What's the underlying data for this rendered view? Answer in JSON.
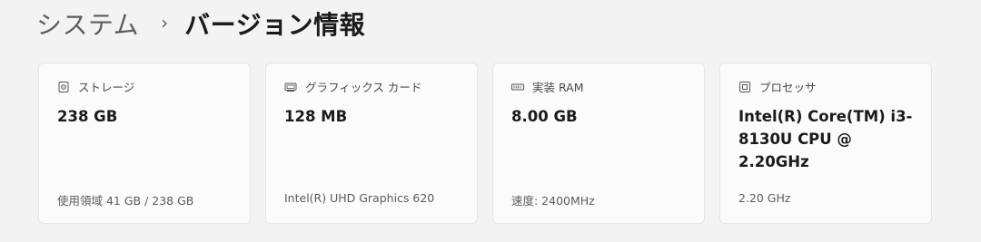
{
  "breadcrumb": {
    "parent": "システム",
    "separator": "›",
    "current": "バージョン情報"
  },
  "cards": [
    {
      "icon": "storage-icon",
      "title": "ストレージ",
      "value": "238 GB",
      "detail": "使用領域 41 GB / 238 GB"
    },
    {
      "icon": "graphics-card-icon",
      "title": "グラフィックス カード",
      "value": "128 MB",
      "detail": "Intel(R) UHD Graphics 620"
    },
    {
      "icon": "memory-icon",
      "title": "実装 RAM",
      "value": "8.00 GB",
      "detail": "速度: 2400MHz"
    },
    {
      "icon": "processor-icon",
      "title": "プロセッサ",
      "value": "Intel(R) Core(TM) i3-8130U CPU @ 2.20GHz",
      "detail": "2.20 GHz"
    }
  ]
}
